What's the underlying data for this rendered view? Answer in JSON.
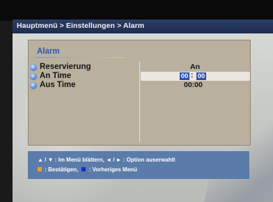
{
  "header": {
    "breadcrumb": "Hauptmenü > Einstellungen > Alarm"
  },
  "panel": {
    "title": "Alarm",
    "items": [
      {
        "label": "Reservierung",
        "value": "An"
      },
      {
        "label": "An Time",
        "hour": "00",
        "separator": ":",
        "minute": "00"
      },
      {
        "label": "Aus Time",
        "value": "00:00"
      }
    ]
  },
  "help": {
    "line1": "▲ / ▼ : Im Menü blättern, ◄ / ► : Option auserwahlt",
    "line2_part1": ": Bestätigen,",
    "line2_part2": ": Vorheriges Menü",
    "confirm_key_color": "#f0a020",
    "back_key_color": "#1030c8"
  },
  "colors": {
    "title": "#2a56b8",
    "help_bg": "#5b7caa",
    "selected_field": "#2f4fae"
  }
}
